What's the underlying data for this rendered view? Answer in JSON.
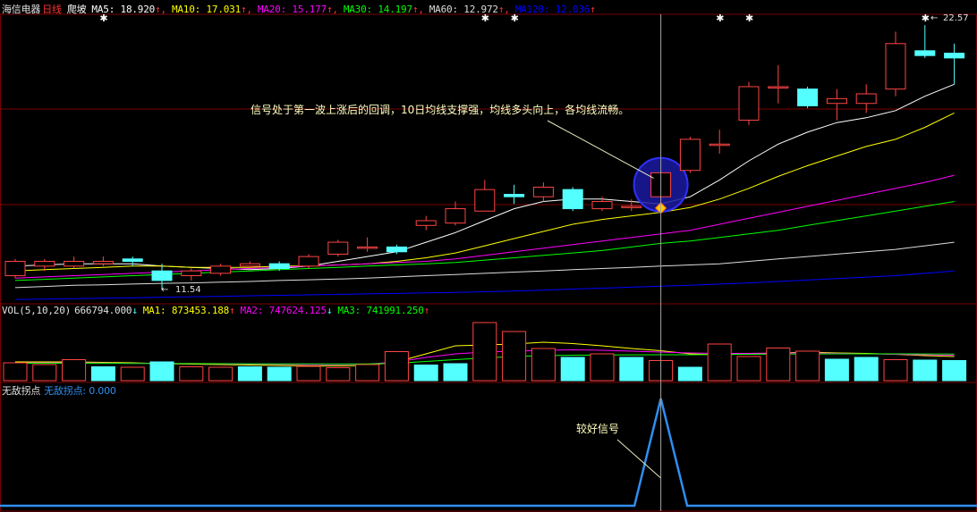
{
  "header": {
    "stock_name": "海信电器",
    "period": "日线",
    "pattern": "爬坡",
    "ma_legend": [
      {
        "label": "MA5: 18.920",
        "arrow": "↑",
        "color": "#ffffff"
      },
      {
        "label": "MA10: 17.031",
        "arrow": "↑",
        "color": "#ffff00"
      },
      {
        "label": "MA20: 15.177",
        "arrow": "↑",
        "color": "#ff00ff"
      },
      {
        "label": "MA30: 14.197",
        "arrow": "↑",
        "color": "#00ff00"
      },
      {
        "label": "MA60: 12.972",
        "arrow": "↑",
        "color": "#dddddd"
      },
      {
        "label": "MA120: 12.036",
        "arrow": "↑",
        "color": "#0000ff"
      }
    ]
  },
  "volume_header": {
    "label": "VOL(5,10,20)",
    "value": "666794.000",
    "value_arrow": "↓",
    "mas": [
      {
        "label": "MA1: 873453.188",
        "arrow": "↑",
        "color": "#ffff00"
      },
      {
        "label": "MA2: 747624.125",
        "arrow": "↓",
        "color": "#ff00ff"
      },
      {
        "label": "MA3: 741991.250",
        "arrow": "↑",
        "color": "#00ff00"
      }
    ]
  },
  "indicator_header": {
    "name": "无敌拐点",
    "value_label": "无敌拐点: 0.000"
  },
  "annotations": {
    "signal_note": "信号处于第一波上涨后的回调，10日均线支撑强，均线多头向上，各均线流畅。",
    "good_signal": "较好信号",
    "high_label": "22.57",
    "low_label": "11.54"
  },
  "colors": {
    "up": "#ff4444",
    "down": "#54ffff",
    "grid": "#7a0000",
    "signal_line": "#2f8ff0",
    "circle_fill": "#1a1aa0"
  },
  "chart_data": [
    {
      "type": "candlestick",
      "title": "海信电器 日线",
      "y_range": [
        11.0,
        22.8
      ],
      "candles": [
        {
          "o": 12.1,
          "c": 12.7,
          "h": 12.8,
          "l": 12.0
        },
        {
          "o": 12.5,
          "c": 12.7,
          "h": 12.8,
          "l": 12.3
        },
        {
          "o": 12.5,
          "c": 12.7,
          "h": 12.9,
          "l": 12.4
        },
        {
          "o": 12.6,
          "c": 12.7,
          "h": 12.9,
          "l": 12.5
        },
        {
          "o": 12.8,
          "c": 12.7,
          "h": 12.9,
          "l": 12.5
        },
        {
          "o": 12.3,
          "c": 11.9,
          "h": 12.6,
          "l": 11.54
        },
        {
          "o": 12.1,
          "c": 12.3,
          "h": 12.4,
          "l": 11.9
        },
        {
          "o": 12.2,
          "c": 12.5,
          "h": 12.6,
          "l": 12.1
        },
        {
          "o": 12.5,
          "c": 12.6,
          "h": 12.7,
          "l": 12.4
        },
        {
          "o": 12.6,
          "c": 12.4,
          "h": 12.7,
          "l": 12.3
        },
        {
          "o": 12.5,
          "c": 12.9,
          "h": 13.0,
          "l": 12.4
        },
        {
          "o": 13.0,
          "c": 13.5,
          "h": 13.6,
          "l": 12.9
        },
        {
          "o": 13.3,
          "c": 13.3,
          "h": 13.7,
          "l": 13.1
        },
        {
          "o": 13.3,
          "c": 13.1,
          "h": 13.4,
          "l": 13.0
        },
        {
          "o": 14.2,
          "c": 14.4,
          "h": 14.6,
          "l": 14.0
        },
        {
          "o": 14.3,
          "c": 14.9,
          "h": 15.2,
          "l": 14.2
        },
        {
          "o": 14.8,
          "c": 15.7,
          "h": 16.1,
          "l": 14.8
        },
        {
          "o": 15.5,
          "c": 15.4,
          "h": 15.9,
          "l": 15.1
        },
        {
          "o": 15.4,
          "c": 15.8,
          "h": 16.0,
          "l": 15.2
        },
        {
          "o": 15.7,
          "c": 14.9,
          "h": 15.8,
          "l": 14.8
        },
        {
          "o": 14.9,
          "c": 15.2,
          "h": 15.4,
          "l": 14.8
        },
        {
          "o": 15.0,
          "c": 15.0,
          "h": 15.3,
          "l": 14.8
        },
        {
          "o": 15.4,
          "c": 16.4,
          "h": 16.5,
          "l": 15.3
        },
        {
          "o": 16.5,
          "c": 17.8,
          "h": 17.9,
          "l": 16.4
        },
        {
          "o": 17.6,
          "c": 17.6,
          "h": 18.2,
          "l": 17.2
        },
        {
          "o": 18.6,
          "c": 20.0,
          "h": 20.2,
          "l": 18.4
        },
        {
          "o": 20.0,
          "c": 20.0,
          "h": 20.9,
          "l": 19.3
        },
        {
          "o": 19.9,
          "c": 19.2,
          "h": 20.0,
          "l": 19.1
        },
        {
          "o": 19.3,
          "c": 19.5,
          "h": 19.9,
          "l": 18.6
        },
        {
          "o": 19.3,
          "c": 19.7,
          "h": 20.1,
          "l": 18.9
        },
        {
          "o": 19.9,
          "c": 21.8,
          "h": 22.3,
          "l": 19.6
        },
        {
          "o": 21.5,
          "c": 21.3,
          "h": 22.57,
          "l": 21.2
        },
        {
          "o": 21.4,
          "c": 21.2,
          "h": 21.8,
          "l": 20.1
        }
      ],
      "ma": {
        "MA5": [
          12.5,
          12.55,
          12.6,
          12.6,
          12.6,
          12.5,
          12.45,
          12.4,
          12.35,
          12.4,
          12.5,
          12.7,
          12.9,
          13.1,
          13.5,
          13.9,
          14.4,
          14.9,
          15.2,
          15.3,
          15.3,
          15.2,
          15.1,
          15.4,
          16.1,
          16.9,
          17.6,
          18.1,
          18.5,
          18.7,
          19.0,
          19.6,
          20.1
        ],
        "MA10": [
          12.3,
          12.35,
          12.4,
          12.45,
          12.5,
          12.5,
          12.45,
          12.45,
          12.45,
          12.5,
          12.5,
          12.55,
          12.6,
          12.7,
          12.85,
          13.05,
          13.35,
          13.65,
          13.95,
          14.25,
          14.45,
          14.6,
          14.75,
          14.95,
          15.3,
          15.75,
          16.25,
          16.7,
          17.1,
          17.5,
          17.8,
          18.3,
          18.9
        ],
        "MA20": [
          12.0,
          12.05,
          12.1,
          12.15,
          12.2,
          12.25,
          12.3,
          12.35,
          12.4,
          12.45,
          12.5,
          12.55,
          12.6,
          12.65,
          12.7,
          12.8,
          12.95,
          13.1,
          13.25,
          13.4,
          13.55,
          13.7,
          13.85,
          14.0,
          14.25,
          14.5,
          14.75,
          15.0,
          15.25,
          15.5,
          15.75,
          16.0,
          16.3
        ],
        "MA30": [
          11.9,
          11.95,
          12.0,
          12.05,
          12.1,
          12.15,
          12.2,
          12.25,
          12.3,
          12.35,
          12.4,
          12.45,
          12.5,
          12.55,
          12.6,
          12.65,
          12.75,
          12.85,
          12.95,
          13.05,
          13.15,
          13.3,
          13.45,
          13.55,
          13.7,
          13.85,
          14.0,
          14.2,
          14.4,
          14.6,
          14.8,
          15.0,
          15.2
        ],
        "MA60": [
          11.6,
          11.65,
          11.7,
          11.72,
          11.75,
          11.78,
          11.8,
          11.83,
          11.86,
          11.9,
          11.93,
          11.96,
          12.0,
          12.05,
          12.1,
          12.15,
          12.2,
          12.25,
          12.3,
          12.35,
          12.4,
          12.45,
          12.5,
          12.55,
          12.6,
          12.7,
          12.8,
          12.9,
          13.0,
          13.1,
          13.2,
          13.35,
          13.5
        ],
        "MA120": [
          11.1,
          11.12,
          11.14,
          11.16,
          11.18,
          11.2,
          11.22,
          11.24,
          11.26,
          11.28,
          11.3,
          11.32,
          11.34,
          11.36,
          11.38,
          11.4,
          11.43,
          11.46,
          11.5,
          11.54,
          11.58,
          11.62,
          11.66,
          11.7,
          11.75,
          11.8,
          11.86,
          11.92,
          11.98,
          12.04,
          12.1,
          12.2,
          12.3
        ]
      },
      "star_markers": [
        3,
        16,
        17,
        24,
        25,
        31
      ],
      "signal_candle": 22
    },
    {
      "type": "bar",
      "title": "VOL(5,10,20)",
      "y_range": [
        0,
        1400000
      ],
      "values": [
        400000,
        360000,
        470000,
        310000,
        300000,
        420000,
        310000,
        300000,
        310000,
        300000,
        320000,
        290000,
        360000,
        650000,
        350000,
        380000,
        1300000,
        1100000,
        720000,
        520000,
        600000,
        520000,
        450000,
        300000,
        820000,
        540000,
        730000,
        660000,
        480000,
        520000,
        470000,
        460000,
        450000
      ],
      "direction": [
        "up",
        "up",
        "up",
        "down",
        "up",
        "down",
        "up",
        "up",
        "down",
        "down",
        "up",
        "up",
        "up",
        "up",
        "down",
        "down",
        "up",
        "up",
        "up",
        "down",
        "up",
        "down",
        "up",
        "down",
        "up",
        "up",
        "up",
        "up",
        "down",
        "down",
        "up",
        "down",
        "down"
      ],
      "ma1": [
        420000,
        420000,
        420000,
        410000,
        400000,
        380000,
        370000,
        360000,
        350000,
        340000,
        330000,
        330000,
        340000,
        420000,
        600000,
        780000,
        800000,
        820000,
        860000,
        830000,
        780000,
        720000,
        670000,
        600000,
        580000,
        600000,
        620000,
        640000,
        620000,
        610000,
        590000,
        560000,
        540000
      ],
      "ma2": [
        400000,
        400000,
        400000,
        395000,
        390000,
        385000,
        380000,
        375000,
        370000,
        365000,
        360000,
        360000,
        370000,
        420000,
        520000,
        600000,
        640000,
        660000,
        680000,
        690000,
        680000,
        660000,
        640000,
        620000,
        610000,
        610000,
        620000,
        620000,
        610000,
        600000,
        590000,
        580000,
        570000
      ],
      "ma3": [
        390000,
        390000,
        390000,
        388000,
        386000,
        384000,
        382000,
        380000,
        378000,
        376000,
        374000,
        372000,
        375000,
        390000,
        430000,
        470000,
        510000,
        540000,
        560000,
        570000,
        575000,
        578000,
        580000,
        580000,
        585000,
        590000,
        595000,
        598000,
        600000,
        600000,
        600000,
        598000,
        596000
      ]
    },
    {
      "type": "line",
      "title": "无敌拐点",
      "y_range": [
        0,
        1
      ],
      "x": [
        0,
        21.1,
        22,
        22.9,
        32.9
      ],
      "y": [
        0,
        0,
        1,
        0,
        0
      ]
    }
  ]
}
